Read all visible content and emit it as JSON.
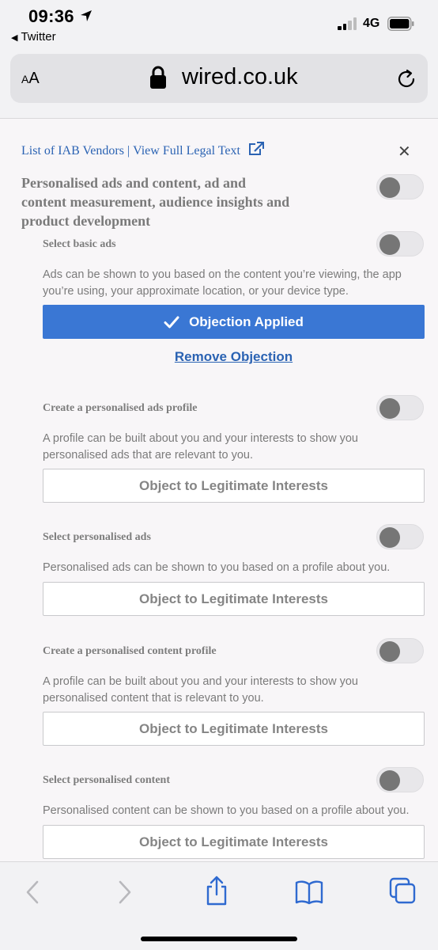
{
  "status": {
    "time": "09:36",
    "back_app": "Twitter",
    "network": "4G"
  },
  "browser": {
    "text_size": "AA",
    "domain": "wired.co.uk"
  },
  "consent": {
    "vendors_link": "List of IAB Vendors",
    "separator": "|",
    "legal_link": "View Full Legal Text",
    "close_label": "✕",
    "main_title": "Personalised ads and content, ad and content measurement, audience insights and product development",
    "items": [
      {
        "title": "Select basic ads",
        "description": "Ads can be shown to you based on the content you’re viewing, the app you’re using, your approximate location, or your device type.",
        "button": "Objection Applied",
        "remove_link": "Remove Objection"
      },
      {
        "title": "Create a personalised ads profile",
        "description": "A profile can be built about you and your interests to show you personalised ads that are relevant to you.",
        "button": "Object to Legitimate Interests"
      },
      {
        "title": "Select personalised ads",
        "description": "Personalised ads can be shown to you based on a profile about you.",
        "button": "Object to Legitimate Interests"
      },
      {
        "title": "Create a personalised content profile",
        "description": "A profile can be built about you and your interests to show you personalised content that is relevant to you.",
        "button": "Object to Legitimate Interests"
      },
      {
        "title": "Select personalised content",
        "description": "Personalised content can be shown to you based on a profile about you.",
        "button": "Object to Legitimate Interests"
      }
    ]
  },
  "colors": {
    "accent": "#3a77d4",
    "link": "#2b63b3",
    "toggle_knob": "#767676"
  }
}
